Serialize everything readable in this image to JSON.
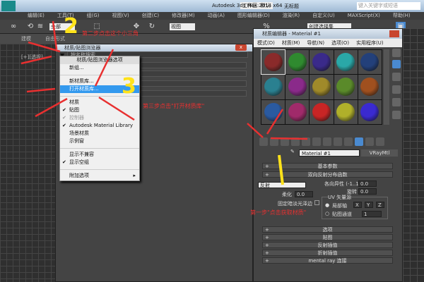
{
  "app": {
    "title": "Autodesk 3ds Max  2014 x64",
    "doc": "无标题",
    "workspace": "工作区: 默认",
    "search_placeholder": "键入关键字或短语"
  },
  "menu": [
    "编辑(E)",
    "工具(T)",
    "组(G)",
    "视图(V)",
    "创建(C)",
    "修改器(M)",
    "动画(A)",
    "图形编辑器(D)",
    "渲染(R)",
    "自定义(U)",
    "MAXScript(X)",
    "帮助(H)"
  ],
  "toolbar": {
    "filter": "全部",
    "view": "视图",
    "selection_set": "创建选择集"
  },
  "tabs": [
    "建模",
    "自由形式"
  ],
  "viewport_label": "[+][透视]",
  "browser": {
    "title": "材质/贴图浏览器",
    "search_placeholder": "按名称搜索..."
  },
  "dropdown": {
    "header": "材质/贴图浏览器选项",
    "items": [
      {
        "label": "新组...",
        "checked": false
      },
      {
        "label": "新材质库...",
        "checked": false
      },
      {
        "label": "打开材质库...",
        "checked": false,
        "highlighted": true
      },
      {
        "label": "材质",
        "checked": false
      },
      {
        "label": "贴图",
        "checked": true
      },
      {
        "label": "控制器",
        "checked": true,
        "disabled": true
      },
      {
        "label": "Autodesk Material Library",
        "checked": true
      },
      {
        "label": "场景材质",
        "checked": false
      },
      {
        "label": "示例窗",
        "checked": false
      },
      {
        "label": "显示不兼容",
        "checked": false
      },
      {
        "label": "显示空组",
        "checked": true
      },
      {
        "label": "附加选项",
        "submenu": true
      }
    ]
  },
  "mated": {
    "title": "材质编辑器 - Material #1",
    "menu": [
      "模式(D)",
      "材质(M)",
      "导航(N)",
      "选项(O)",
      "实用程序(U)"
    ],
    "sample_colors": [
      "#8a2a2a",
      "#2f8a2f",
      "#3a2a8a",
      "#2aa8a8",
      "#23407a",
      "#2a8090",
      "#8a2a8a",
      "#a08a2a",
      "#5a8a2a",
      "#a0501f",
      "#2a5aa0",
      "#a02a6a",
      "#c82525",
      "#b0b02a",
      "#3a2ad0"
    ],
    "material_name": "Material #1",
    "material_type": "VRayMtl",
    "rollouts": {
      "basic": "基本参数",
      "brdf": "双向反射分布函数",
      "options": "选项",
      "maps": "贴图",
      "reflect_interp": "反射插值",
      "refract_interp": "折射插值",
      "mental_ray": "mental ray 连接"
    },
    "brdf": {
      "type": "反射",
      "anisotropy_label": "各向异性 (-1..1)",
      "anisotropy": "0.0",
      "rotation_label": "旋转",
      "rotation": "0.0",
      "soften_label": "柔化",
      "soften": "0.0",
      "fix_label": "固定暗淡光泽边",
      "uv_group": "UV 矢量源",
      "local_axis": "局部轴",
      "map_channel": "贴图通道",
      "channel": "1",
      "x": "X",
      "y": "Y",
      "z": "Z"
    }
  },
  "annotations": {
    "step1": "第一步\"点击获取材质\"",
    "step2": "第二步点击这个小三角",
    "step3": "第三步点击\"打开材质库\"",
    "num2": "2",
    "num3": "3"
  },
  "colors": {
    "annotation_red": "#e83030",
    "annotation_yellow": "#ffe21a",
    "highlight": "#3399ee"
  }
}
